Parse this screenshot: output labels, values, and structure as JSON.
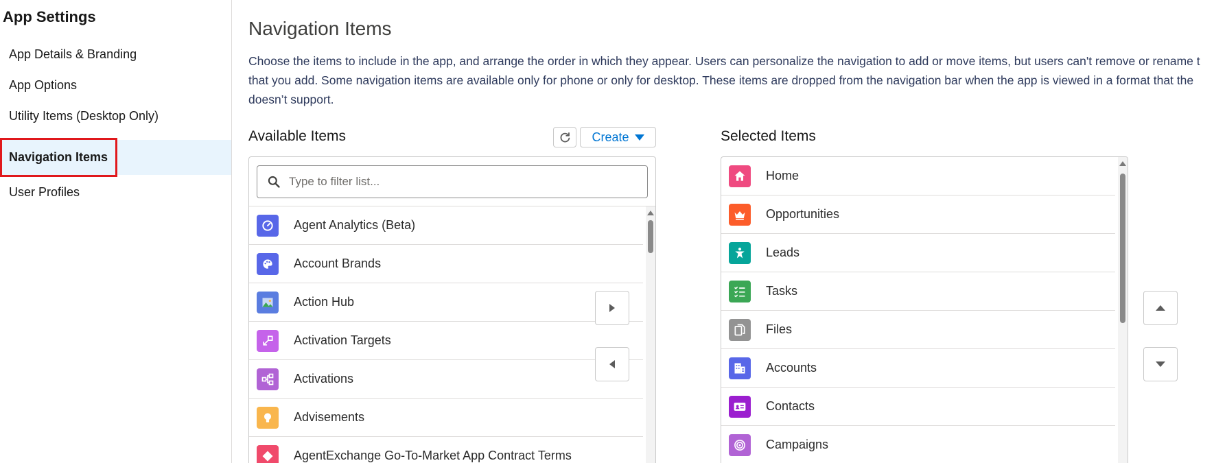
{
  "sidebar": {
    "title": "App Settings",
    "items": [
      {
        "label": "App Details & Branding"
      },
      {
        "label": "App Options"
      },
      {
        "label": "Utility Items (Desktop Only)"
      },
      {
        "label": "Navigation Items"
      },
      {
        "label": "User Profiles"
      }
    ],
    "active_item": "Navigation Items"
  },
  "main": {
    "title": "Navigation Items",
    "description_lines": [
      "Choose the items to include in the app, and arrange the order in which they appear. Users can personalize the navigation to add or move items, but users can't remove or rename t",
      "that you add. Some navigation items are available only for phone or only for desktop. These items are dropped from the navigation bar when the app is viewed in a format that the",
      "doesn’t support."
    ]
  },
  "available": {
    "label": "Available Items",
    "create_label": "Create",
    "filter_placeholder": "Type to filter list...",
    "items": [
      {
        "label": "Agent Analytics (Beta)",
        "icon": "gauge-icon",
        "color": "#5867e8"
      },
      {
        "label": "Account Brands",
        "icon": "palette-icon",
        "color": "#5867e8"
      },
      {
        "label": "Action Hub",
        "icon": "image-icon",
        "color": "#5a7de0"
      },
      {
        "label": "Activation Targets",
        "icon": "expand-icon",
        "color": "#c563ea"
      },
      {
        "label": "Activations",
        "icon": "hierarchy-icon",
        "color": "#b163d5"
      },
      {
        "label": "Advisements",
        "icon": "lightbulb-icon",
        "color": "#f9b64d"
      },
      {
        "label": "AgentExchange Go-To-Market App Contract Terms",
        "icon": "diamond-icon",
        "color": "#f04a6b"
      }
    ]
  },
  "selected": {
    "label": "Selected Items",
    "items": [
      {
        "label": "Home",
        "icon": "home-icon",
        "color": "#ef4a80"
      },
      {
        "label": "Opportunities",
        "icon": "crown-icon",
        "color": "#fc5c2a"
      },
      {
        "label": "Leads",
        "icon": "person-star-icon",
        "color": "#06a59a"
      },
      {
        "label": "Tasks",
        "icon": "checklist-icon",
        "color": "#3ba755"
      },
      {
        "label": "Files",
        "icon": "files-icon",
        "color": "#939393"
      },
      {
        "label": "Accounts",
        "icon": "building-icon",
        "color": "#5867e8"
      },
      {
        "label": "Contacts",
        "icon": "contact-card-icon",
        "color": "#9b1ecf"
      },
      {
        "label": "Campaigns",
        "icon": "target-icon",
        "color": "#b163d5"
      }
    ]
  }
}
